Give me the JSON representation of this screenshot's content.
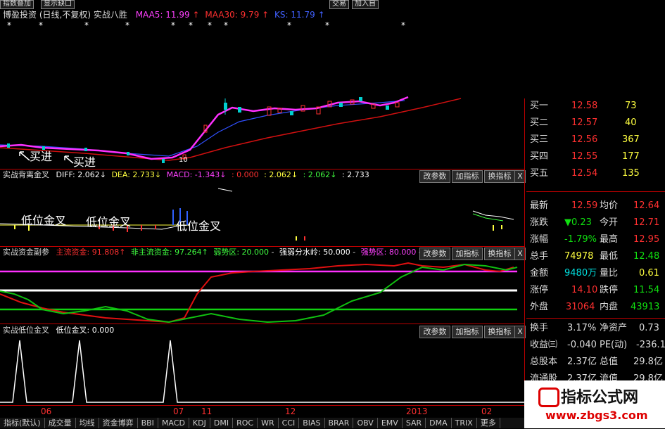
{
  "topbar": {
    "left_items": [
      "指数叠加",
      "显示缺口"
    ],
    "right_items": [
      "交易",
      "加入自"
    ]
  },
  "main_header": {
    "stock": "博盈投资",
    "period": "(日线,不复权)",
    "indicator": "实战八胜",
    "maa5": "MAA5: 11.99",
    "maa30": "MAA30: 9.79",
    "ks": "KS: 11.79"
  },
  "main_annotations": [
    "买进",
    "买进",
    "10"
  ],
  "panel1": {
    "name": "实战背离金叉",
    "diff": "DIFF: 2.062",
    "dea": "DEA: 2.733",
    "macd": "MACD: -1.343",
    "v1": ": 0.000",
    "v2": ": 2.062",
    "v3": ": 2.062",
    "v4": ": 2.733",
    "annotations": [
      "低位金叉",
      "低位金叉",
      "低位金叉"
    ]
  },
  "panel2": {
    "name": "实战资金副参",
    "main_funds": "主流资金: 91.808",
    "non_main_funds": "非主流资金: 97.264",
    "weak_zone": "弱势区: 20.000",
    "watershed": "强弱分水岭: 50.000",
    "strong_zone": "强势区: 80.000"
  },
  "panel3": {
    "name": "实战低位金叉",
    "value": "低位金叉: 0.000"
  },
  "buttons": {
    "params": "改参数",
    "add_indicator": "加指标",
    "swap_indicator": "换指标",
    "close": "X"
  },
  "quotes": {
    "bids": [
      {
        "label": "买一",
        "price": "12.58",
        "vol": "73"
      },
      {
        "label": "买二",
        "price": "12.57",
        "vol": "40"
      },
      {
        "label": "买三",
        "price": "12.56",
        "vol": "367"
      },
      {
        "label": "买四",
        "price": "12.55",
        "vol": "177"
      },
      {
        "label": "买五",
        "price": "12.54",
        "vol": "135"
      }
    ],
    "stats": [
      {
        "l1": "最新",
        "v1": "12.59",
        "l2": "均价",
        "v2": "12.64"
      },
      {
        "l1": "涨跌",
        "v1": "▼0.23",
        "l2": "今开",
        "v2": "12.71"
      },
      {
        "l1": "涨幅",
        "v1": "-1.79%",
        "l2": "最高",
        "v2": "12.95"
      },
      {
        "l1": "总手",
        "v1": "74978",
        "l2": "最低",
        "v2": "12.48"
      },
      {
        "l1": "金额",
        "v1": "9480万",
        "l2": "量比",
        "v2": "0.61"
      },
      {
        "l1": "涨停",
        "v1": "14.10",
        "l2": "跌停",
        "v2": "11.54"
      },
      {
        "l1": "外盘",
        "v1": "31064",
        "l2": "内盘",
        "v2": "43913"
      },
      {
        "l1": "换手",
        "v1": "3.17%",
        "l2": "净资产",
        "v2": "0.73"
      },
      {
        "l1": "收益㈢",
        "v1": "-0.040",
        "l2": "PE(动)",
        "v2": "-236.1"
      },
      {
        "l1": "总股本",
        "v1": "2.37亿",
        "l2": "总值",
        "v2": "29.8亿"
      },
      {
        "l1": "流通股",
        "v1": "2.37亿",
        "l2": "流值",
        "v2": "29.8亿"
      }
    ]
  },
  "x_axis_labels": [
    "06",
    "07",
    "11",
    "12",
    "2013",
    "02"
  ],
  "bottom_tabs": [
    "指标(默认)",
    "成交量",
    "均线",
    "资金博弈",
    "BBI",
    "MACD",
    "KDJ",
    "DMI",
    "ROC",
    "WR",
    "CCI",
    "BIAS",
    "BRAR",
    "OBV",
    "EMV",
    "SAR",
    "DMA",
    "TRIX",
    "更多"
  ],
  "watermark": {
    "title": "指标公式网",
    "url": "www.zbgs3.com"
  },
  "colors": {
    "red_line": "#d01010",
    "magenta": "#ff00ff",
    "blue": "#3050ff",
    "green": "#10d010",
    "white": "#ffffff",
    "yellow": "#ffff40",
    "cyan": "#00e0e0"
  }
}
